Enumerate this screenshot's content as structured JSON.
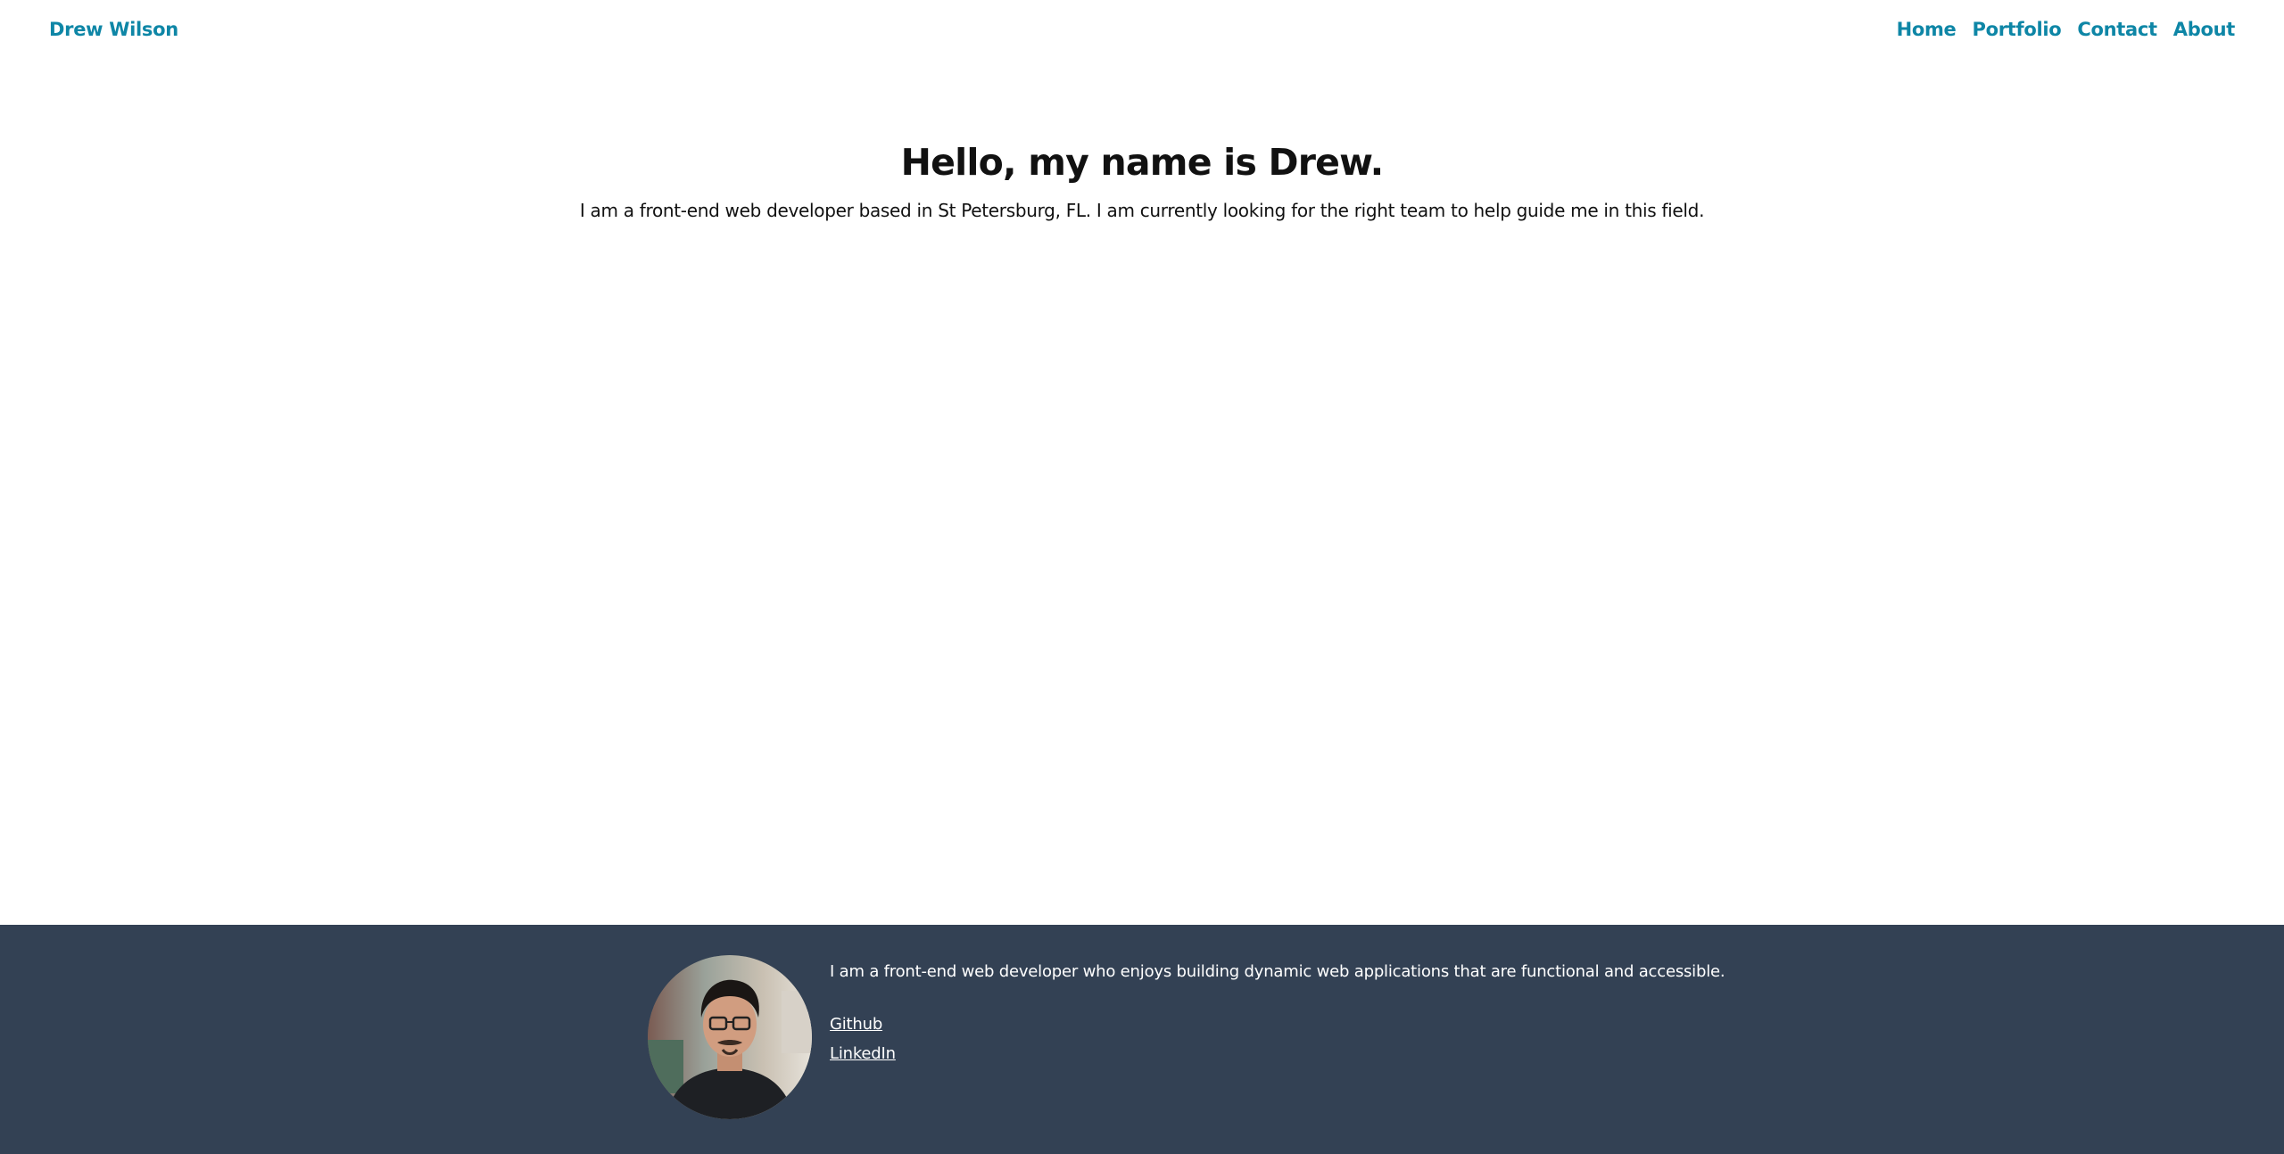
{
  "header": {
    "brand": "Drew Wilson",
    "nav": [
      {
        "label": "Home"
      },
      {
        "label": "Portfolio"
      },
      {
        "label": "Contact"
      },
      {
        "label": "About"
      }
    ]
  },
  "hero": {
    "title": "Hello, my name is Drew.",
    "subtitle": "I am a front-end web developer based in St Petersburg, FL. I am currently looking for the right team to help guide me in this field."
  },
  "footer": {
    "bio": "I am a front-end web developer who enjoys building dynamic web applications that are functional and accessible.",
    "links": [
      {
        "label": "Github"
      },
      {
        "label": "LinkedIn"
      }
    ]
  },
  "colors": {
    "accent": "#0e86a6",
    "footer_bg": "#334154",
    "text": "#111111"
  }
}
